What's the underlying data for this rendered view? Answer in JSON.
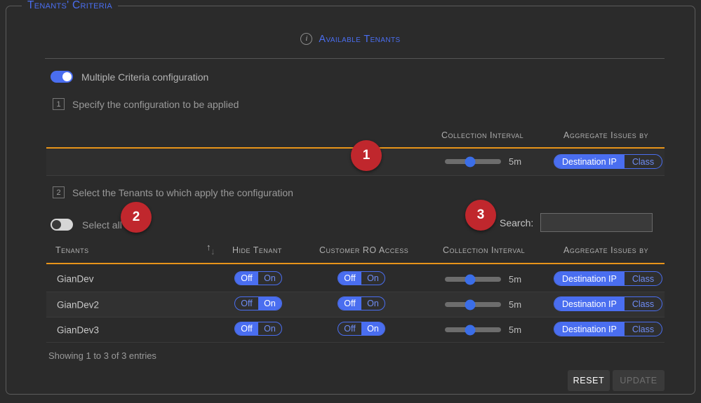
{
  "panel": {
    "legend": "Tenants' Criteria",
    "available_label": "Available Tenants",
    "info_icon": "info-icon",
    "info_glyph": "i"
  },
  "multiple_criteria": {
    "label": "Multiple Criteria configuration",
    "state": "on"
  },
  "steps": [
    {
      "number": "1",
      "text": "Specify the configuration to be applied"
    },
    {
      "number": "2",
      "text": "Select the Tenants to which apply the configuration"
    }
  ],
  "config_headers": {
    "collection_interval": "Collection Interval",
    "aggregate_issues_by": "Aggregate Issues by"
  },
  "config_row": {
    "interval_value": "5m",
    "aggregate_active": "Destination IP",
    "aggregate_inactive": "Class"
  },
  "select_all": {
    "label": "Select all",
    "state": "off"
  },
  "search": {
    "label": "Search:",
    "value": "",
    "placeholder": ""
  },
  "table": {
    "headers": {
      "tenants": "Tenants",
      "hide_tenant": "Hide Tenant",
      "customer_ro_access": "Customer RO Access",
      "collection_interval": "Collection Interval",
      "aggregate_issues_by": "Aggregate Issues by"
    },
    "sort_icon": "sort-arrows-icon",
    "toggle_off_label": "Off",
    "toggle_on_label": "On",
    "rows": [
      {
        "name": "GianDev",
        "hide_tenant": "Off",
        "customer_ro_access": "Off",
        "interval_value": "5m",
        "aggregate_active": "Destination IP",
        "aggregate_inactive": "Class"
      },
      {
        "name": "GianDev2",
        "hide_tenant": "On",
        "customer_ro_access": "Off",
        "interval_value": "5m",
        "aggregate_active": "Destination IP",
        "aggregate_inactive": "Class"
      },
      {
        "name": "GianDev3",
        "hide_tenant": "Off",
        "customer_ro_access": "On",
        "interval_value": "5m",
        "aggregate_active": "Destination IP",
        "aggregate_inactive": "Class"
      }
    ]
  },
  "footer": {
    "showing": "Showing 1 to 3 of 3 entries",
    "reset_label": "RESET",
    "update_label": "UPDATE"
  },
  "callouts": [
    {
      "number": "1"
    },
    {
      "number": "2"
    },
    {
      "number": "3"
    }
  ],
  "colors": {
    "accent_blue": "#4a6ef0",
    "rule_orange": "#e8941a",
    "badge_red": "#c0272d",
    "background": "#2b2b2b"
  }
}
